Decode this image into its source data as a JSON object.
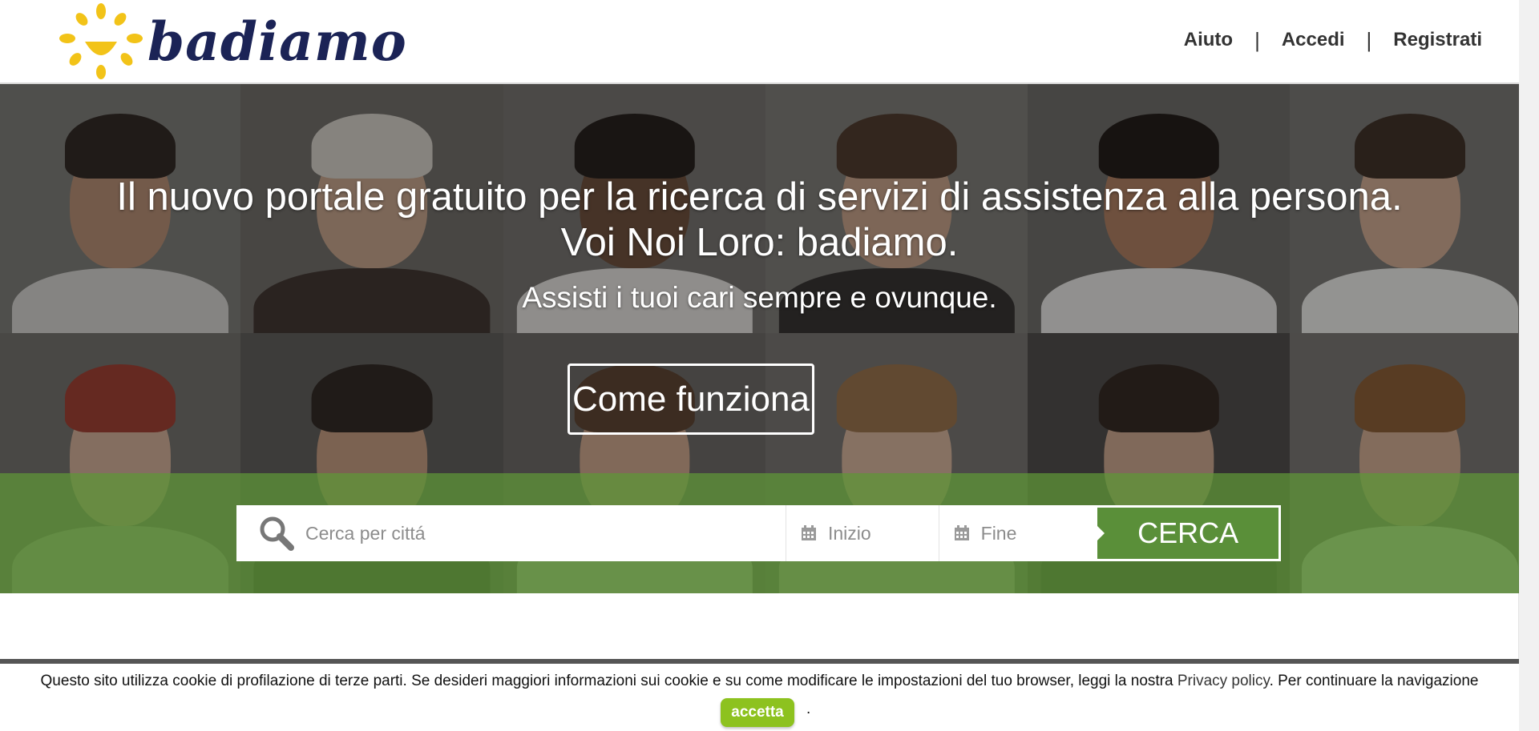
{
  "header": {
    "logo_text": "badiamo",
    "nav": {
      "help": "Aiuto",
      "sep": "|",
      "login": "Accedi",
      "register": "Registrati"
    }
  },
  "hero": {
    "title_line1": "Il nuovo portale gratuito per la ricerca di servizi di assistenza alla persona.",
    "title_line2": "Voi Noi Loro: badiamo.",
    "subtitle": "Assisti i tuoi cari sempre e ovunque.",
    "how_button": "Come funziona"
  },
  "search": {
    "city_placeholder": "Cerca per cittá",
    "start_placeholder": "Inizio",
    "end_placeholder": "Fine",
    "submit_label": "CERCA",
    "icons": [
      "search-icon",
      "calendar-icon"
    ]
  },
  "cookie": {
    "text_before": "Questo sito utilizza cookie di profilazione di terze parti. Se desideri maggiori informazioni sui cookie e su come modificare le impostazioni del tuo browser, leggi la nostra ",
    "privacy_link": "Privacy policy",
    "text_after": ". Per continuare la navigazione",
    "accept_label": "accetta",
    "trailing": "."
  },
  "colors": {
    "brand_navy": "#1b2356",
    "brand_yellow": "#f2c318",
    "search_green": "#5a8f39",
    "accept_green": "#8dc21f"
  }
}
